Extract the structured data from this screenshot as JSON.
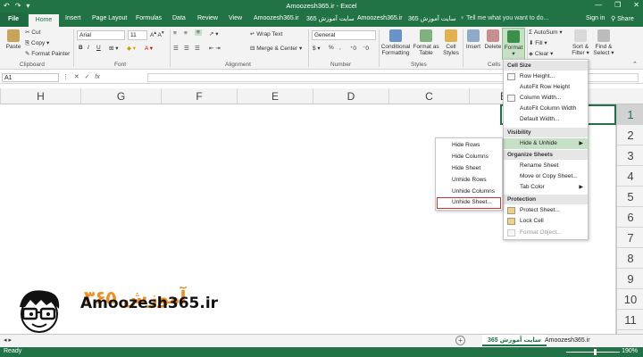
{
  "titlebar": {
    "title": "Amoozesh365.ir - Excel",
    "qat": [
      "↶",
      "↷",
      "▾"
    ],
    "win": [
      "—",
      "❐",
      "✕"
    ]
  },
  "tabs": {
    "file": "File",
    "home": "Home",
    "insert": "Insert",
    "page_layout": "Page Layout",
    "formulas": "Formulas",
    "data": "Data",
    "review": "Review",
    "view": "View",
    "extra1": "Amoozesh365.ir",
    "extra2": "سایت آموزش 365",
    "extra3": "Amoozesh365.ir",
    "extra4": "سایت آموزش 365",
    "tell_me": "Tell me what you want to do...",
    "sign_in": "Sign in",
    "share": "Share"
  },
  "ribbon": {
    "clipboard": {
      "paste": "Paste",
      "cut": "Cut",
      "copy": "Copy",
      "format_painter": "Format Painter",
      "label": "Clipboard"
    },
    "font": {
      "name": "Arial",
      "size": "11",
      "bold": "B",
      "italic": "I",
      "underline": "U",
      "label": "Font"
    },
    "alignment": {
      "wrap_text": "Wrap Text",
      "merge_center": "Merge & Center",
      "label": "Alignment"
    },
    "number": {
      "format": "General",
      "label": "Number",
      "currency": "$",
      "percent": "%"
    },
    "styles": {
      "conditional": "Conditional",
      "conditional2": "Formatting",
      "format_as": "Format as",
      "table": "Table",
      "cell": "Cell",
      "styles": "Styles",
      "label": "Styles"
    },
    "cells": {
      "insert": "Insert",
      "delete": "Delete",
      "format": "Format",
      "label": "Cells"
    },
    "editing": {
      "autosum": "AutoSum",
      "fill": "Fill",
      "clear": "Clear",
      "sort": "Sort &",
      "filter": "Filter",
      "find": "Find &",
      "select": "Select"
    }
  },
  "formula_bar": {
    "name_box": "A1",
    "fx": "fx"
  },
  "columns": [
    "H",
    "G",
    "F",
    "E",
    "D",
    "C",
    "B"
  ],
  "rows": [
    "1",
    "2",
    "3",
    "4",
    "5",
    "6",
    "7",
    "8",
    "9",
    "10",
    "11"
  ],
  "format_menu": {
    "cell_size": "Cell Size",
    "row_height": "Row Height...",
    "autofit_row": "AutoFit Row Height",
    "column_width": "Column Width...",
    "autofit_col": "AutoFit Column Width",
    "default_width": "Default Width...",
    "visibility": "Visibility",
    "hide_unhide": "Hide & Unhide",
    "organize": "Organize Sheets",
    "rename": "Rename Sheet",
    "move_copy": "Move or Copy Sheet...",
    "tab_color": "Tab Color",
    "protection": "Protection",
    "protect": "Protect Sheet...",
    "lock": "Lock Cell",
    "format_object": "Format Object..."
  },
  "submenu": {
    "hide_rows": "Hide Rows",
    "hide_columns": "Hide Columns",
    "hide_sheet": "Hide Sheet",
    "unhide_rows": "Unhide Rows",
    "unhide_columns": "Unhide Columns",
    "unhide_sheet": "Unhide Sheet..."
  },
  "sheets": {
    "active": "سایت آموزش 365",
    "other": "Amoozesh365.ir"
  },
  "status": {
    "ready": "Ready",
    "zoom": "190%"
  },
  "logo": {
    "text": "Amoozesh365.ir",
    "persian": "آموزش ۳۶۵"
  },
  "colors": {
    "excel_green": "#217346",
    "highlight": "#c6e0c5",
    "red_box": "#d62e2e"
  }
}
